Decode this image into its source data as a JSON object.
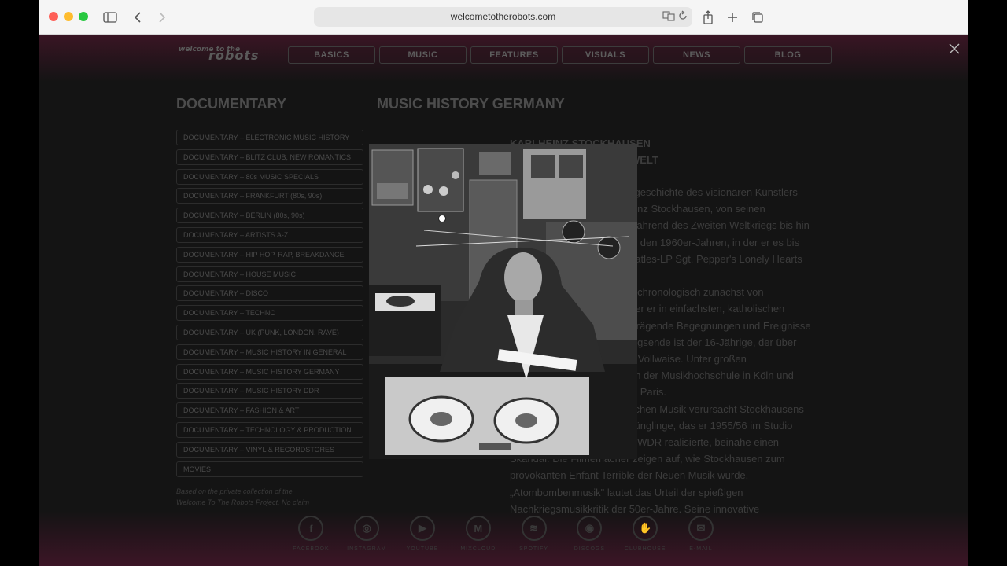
{
  "browser": {
    "url": "welcometotherobots.com"
  },
  "site": {
    "logo_line1": "welcome to the",
    "logo_line2": "robots",
    "nav": [
      "BASICS",
      "MUSIC",
      "FEATURES",
      "VISUALS",
      "NEWS",
      "BLOG"
    ]
  },
  "sidebar": {
    "title": "DOCUMENTARY",
    "items": [
      "DOCUMENTARY – ELECTRONIC MUSIC HISTORY",
      "DOCUMENTARY – BLITZ CLUB, NEW ROMANTICS",
      "DOCUMENTARY – 80s MUSIC SPECIALS",
      "DOCUMENTARY – FRANKFURT (80s, 90s)",
      "DOCUMENTARY – BERLIN (80s, 90s)",
      "DOCUMENTARY – ARTISTS A-Z",
      "DOCUMENTARY – HIP HOP, RAP, BREAKDANCE",
      "DOCUMENTARY – HOUSE MUSIC",
      "DOCUMENTARY – DISCO",
      "DOCUMENTARY – TECHNO",
      "DOCUMENTARY – UK (PUNK, LONDON, RAVE)",
      "DOCUMENTARY – MUSIC HISTORY IN GENERAL",
      "DOCUMENTARY – MUSIC HISTORY GERMANY",
      "DOCUMENTARY – MUSIC HISTORY DDR",
      "DOCUMENTARY – FASHION & ART",
      "DOCUMENTARY – TECHNOLOGY & PRODUCTION",
      "DOCUMENTARY – VINYL & RECORDSTORES",
      "MOVIES"
    ],
    "note_line1": "Based on the private collection of the",
    "note_line2": "Welcome To The Robots Project. No claim"
  },
  "main": {
    "title": "MUSIC HISTORY GERMANY",
    "article_heading_line1": "KARLHEINZ STOCKHAUSEN",
    "article_heading_line2": "WELT",
    "lines": [
      "sgeschichte des visionären Künstlers",
      "einz Stockhausen, von seinen",
      "während des Zweiten Weltkriegs bis hin",
      "in den 1960er-Jahren, in der er es bis",
      "eatles-LP Sgt. Pepper's Lonely Hearts",
      "",
      "lt chronologisch zunächst von",
      "der er in einfachsten, katholischen",
      "Prägende Begegnungen und Ereignisse",
      "iegsende ist der 16-Jährige, der über",
      "t, Vollwaise. Unter großen",
      "an der Musikhochschule in Köln und",
      "in Paris.",
      "schen Musik verursacht Stockhausens",
      "Jünglinge, das er 1955/56 im Studio",
      "s WDR realisierte, beinahe einen",
      "Skandal. Die Filmemacher zeigen auf, wie Stockhausen zum",
      "provokanten Enfant Terrible der Neuen Musik wurde.",
      "„Atombombenmusik\" lautet das Urteil der spießigen",
      "Nachkriegsmusikkritik der 50er-Jahre. Seine innovative"
    ]
  },
  "social": [
    {
      "label": "FACEBOOK",
      "glyph": "f"
    },
    {
      "label": "INSTAGRAM",
      "glyph": "◎"
    },
    {
      "label": "YOUTUBE",
      "glyph": "▶"
    },
    {
      "label": "MIXCLOUD",
      "glyph": "M"
    },
    {
      "label": "SPOTIFY",
      "glyph": "≋"
    },
    {
      "label": "DISCOGS",
      "glyph": "◉"
    },
    {
      "label": "CLUBHOUSE",
      "glyph": "✋"
    },
    {
      "label": "E-MAIL",
      "glyph": "✉"
    }
  ]
}
